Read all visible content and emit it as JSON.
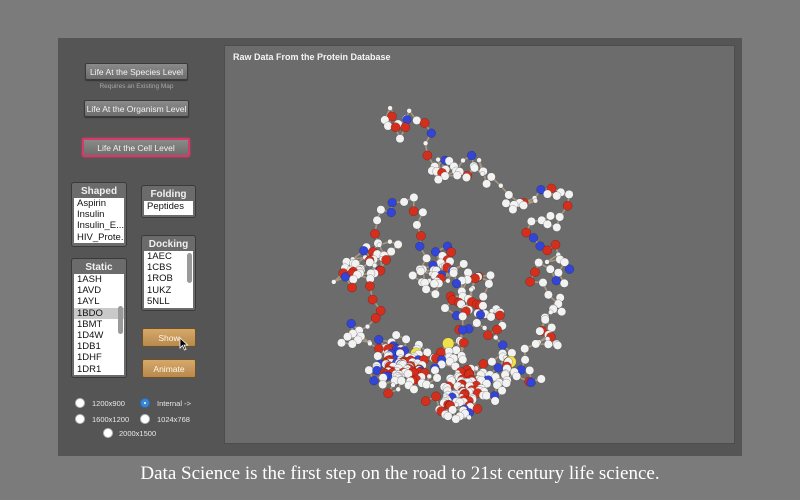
{
  "left_panel": {
    "species_button": "Life At the Species Level",
    "species_note": "Requires an Existing Map",
    "organism_button": "Life At the Organism Level",
    "cell_button": "Life At the Cell Level"
  },
  "lists": {
    "shaped": {
      "header": "Shaped",
      "items": [
        "Aspirin",
        "Insulin",
        "Insulin_E...",
        "HIV_Prote..."
      ]
    },
    "folding": {
      "header": "Folding",
      "items": [
        "Peptides"
      ]
    },
    "docking": {
      "header": "Docking",
      "items": [
        "1AEC",
        "1CBS",
        "1ROB",
        "1UKZ",
        "5NLL"
      ]
    },
    "static": {
      "header": "Static",
      "items": [
        "1ASH",
        "1AVD",
        "1AYL",
        "1BDO",
        "1BMT",
        "1D4W",
        "1DB1",
        "1DHF",
        "1DR1"
      ],
      "selected": "1BDO"
    }
  },
  "actions": {
    "show": "Show",
    "animate": "Animate"
  },
  "resolution": {
    "options": [
      "1200x900",
      "Internal ->",
      "1600x1200",
      "1024x768",
      "2000x1500"
    ],
    "selected": "Internal ->"
  },
  "viewer": {
    "title": "Raw Data From the Protein Database"
  },
  "caption": "Data Science is the first step on the road to 21st century life science.",
  "colors": {
    "oxygen": "#d62e1c",
    "nitrogen": "#3345d8",
    "carbon": "#f2f2f2",
    "sulfur": "#f0e04a",
    "bond": "#a89880"
  }
}
